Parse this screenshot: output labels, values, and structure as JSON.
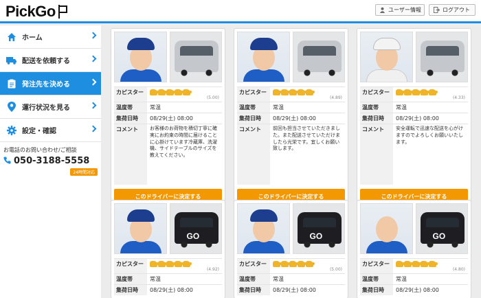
{
  "header": {
    "logo": "PickGo",
    "user_info": "ユーザー情報",
    "logout": "ログアウト"
  },
  "sidebar": {
    "items": [
      {
        "label": "ホーム",
        "icon": "home-icon"
      },
      {
        "label": "配送を依頼する",
        "icon": "truck-icon"
      },
      {
        "label": "発注先を決める",
        "icon": "clipboard-icon"
      },
      {
        "label": "運行状況を見る",
        "icon": "map-pin-icon"
      },
      {
        "label": "設定・確認",
        "icon": "gear-icon"
      }
    ],
    "active_index": 2,
    "contact": {
      "label": "お電話のお問い合わせ/ご相談",
      "phone": "050-3188-5558",
      "badge": "24時間対応"
    }
  },
  "labels": {
    "rating": "カピスター",
    "temperature": "温度帯",
    "pickup": "集荷日時",
    "comment": "コメント",
    "choose_button": "このドライバーに決定する"
  },
  "colors": {
    "accent": "#1e8ee0",
    "button": "#f39800"
  },
  "drivers": [
    {
      "stars": 5,
      "score": "(5.00)",
      "temperature": "常温",
      "pickup": "08/29(土) 08:00",
      "comment": "お客様のお荷物を積切丁寧に確実にお約束の時間に届けることに心掛けています冷蔵庫、洗濯機、サイドテーブルのサイズを教えてください。",
      "vehicle": "silver"
    },
    {
      "stars": 5,
      "score": "(4.89)",
      "temperature": "常温",
      "pickup": "08/29(土) 08:00",
      "comment": "前回も担当させていただきました。また配送させていただけましたら光栄です。宜しくお願い致します。",
      "vehicle": "silver"
    },
    {
      "stars": 5,
      "score": "(4.33)",
      "temperature": "常温",
      "pickup": "08/29(土) 08:00",
      "comment": "安全運転で迅速な配送を心がけますのでよろしくお願いいたします。",
      "vehicle": "silver"
    },
    {
      "stars": 5,
      "score": "(4.92)",
      "temperature": "常温",
      "pickup": "08/29(土) 08:00",
      "comment": "",
      "vehicle": "black"
    },
    {
      "stars": 5,
      "score": "(5.00)",
      "temperature": "常温",
      "pickup": "08/29(土) 08:00",
      "comment": "",
      "vehicle": "black"
    },
    {
      "stars": 5,
      "score": "(4.80)",
      "temperature": "常温",
      "pickup": "08/29(土) 08:00",
      "comment": "",
      "vehicle": "black"
    }
  ]
}
